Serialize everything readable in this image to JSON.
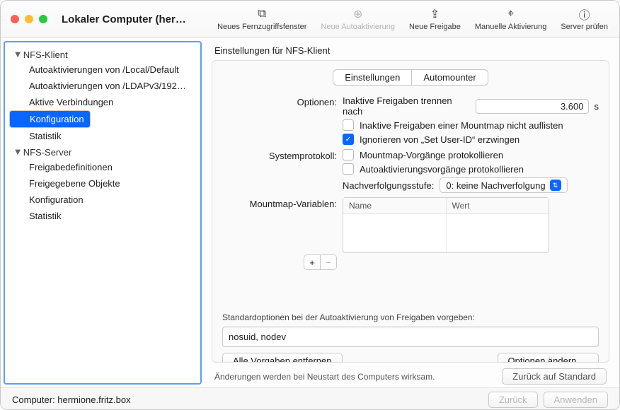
{
  "window": {
    "title": "Lokaler Computer (her…"
  },
  "toolbar": {
    "new_remote": "Neues Fernzugriffsfenster",
    "new_auto": "Neue Autoaktivierung",
    "new_share": "Neue Freigabe",
    "manual_act": "Manuelle Aktivierung",
    "check_srv": "Server prüfen"
  },
  "sidebar": {
    "groups": [
      {
        "label": "NFS-Klient",
        "items": [
          "Autoaktivierungen von /Local/Default",
          "Autoaktivierungen von /LDAPv3/192…",
          "Aktive Verbindungen",
          "Konfiguration",
          "Statistik"
        ],
        "selected_index": 3
      },
      {
        "label": "NFS-Server",
        "items": [
          "Freigabedefinitionen",
          "Freigegebene Objekte",
          "Konfiguration",
          "Statistik"
        ],
        "selected_index": -1
      }
    ]
  },
  "main": {
    "title": "Einstellungen für NFS-Klient",
    "tabs": {
      "settings": "Einstellungen",
      "automounter": "Automounter",
      "active": "automounter"
    },
    "labels": {
      "options": "Optionen:",
      "syslog": "Systemprotokoll:",
      "trace_level": "Nachverfolgungsstufe:",
      "mmvars": "Mountmap-Variablen:",
      "col_name": "Name",
      "col_value": "Wert",
      "timeout_text": "Inaktive Freigaben trennen nach",
      "timeout_unit": "s",
      "chk_nolist": "Inaktive Freigaben einer Mountmap nicht auflisten",
      "chk_setuid": "Ignorieren von „Set User-ID“ erzwingen",
      "chk_logmm": "Mountmap-Vorgänge protokollieren",
      "chk_logauto": "Autoaktivierungsvorgänge protokollieren",
      "std_title": "Standardoptionen bei der Autoaktivierung von Freigaben vorgeben:",
      "remove_all": "Alle Vorgaben entfernen",
      "edit_opts": "Optionen ändern …",
      "reboot_note": "Änderungen werden bei Neustart des Computers wirksam.",
      "reset": "Zurück auf Standard"
    },
    "values": {
      "timeout": "3.600",
      "nolist": false,
      "setuid": true,
      "logmm": false,
      "logauto": false,
      "trace_sel": "0: keine Nachverfolgung",
      "std_opts": "nosuid, nodev"
    }
  },
  "footer": {
    "computer_label": "Computer: hermione.fritz.box",
    "back": "Zurück",
    "apply": "Anwenden"
  }
}
